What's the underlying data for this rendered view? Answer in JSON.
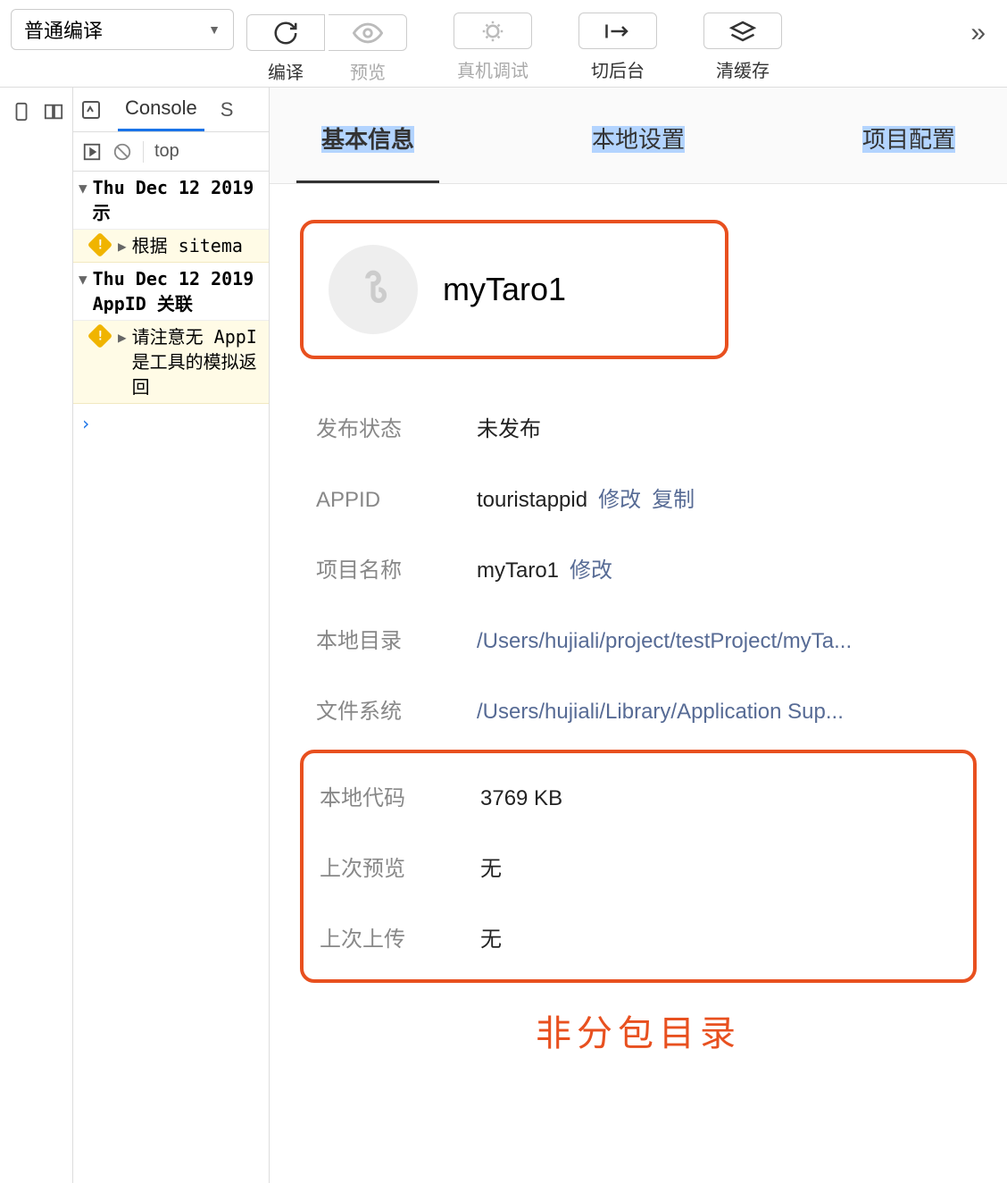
{
  "toolbar": {
    "compile_dropdown": "普通编译",
    "compile_label": "编译",
    "preview_label": "预览",
    "realdevice_label": "真机调试",
    "background_label": "切后台",
    "clearcache_label": "清缓存"
  },
  "console": {
    "tab_console": "Console",
    "tab_sources_cut": "S",
    "filter_top": "top",
    "msg1_line1": "Thu Dec 12 2019",
    "msg1_line2": "示",
    "warn1": "根据 sitema",
    "msg2_line1": "Thu Dec 12 2019",
    "msg2_line2": "AppID 关联",
    "warn2_line1": "请注意无 AppI",
    "warn2_line2": "是工具的模拟返回"
  },
  "detail": {
    "tabs": {
      "basic": "基本信息",
      "local": "本地设置",
      "project": "项目配置"
    },
    "app_name": "myTaro1",
    "rows": {
      "publish_label": "发布状态",
      "publish_value": "未发布",
      "appid_label": "APPID",
      "appid_value": "touristappid",
      "appid_modify": "修改",
      "appid_copy": "复制",
      "projname_label": "项目名称",
      "projname_value": "myTaro1",
      "projname_modify": "修改",
      "localdir_label": "本地目录",
      "localdir_value": "/Users/hujiali/project/testProject/myTa...",
      "filesys_label": "文件系统",
      "filesys_value": "/Users/hujiali/Library/Application Sup...",
      "localcode_label": "本地代码",
      "localcode_value": "3769 KB",
      "lastpreview_label": "上次预览",
      "lastpreview_value": "无",
      "lastupload_label": "上次上传",
      "lastupload_value": "无"
    },
    "annotation": "非分包目录"
  }
}
